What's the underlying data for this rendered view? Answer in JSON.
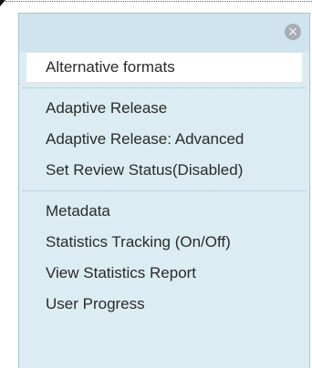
{
  "menu": {
    "close_icon": "×",
    "groups": [
      {
        "items": [
          {
            "label": "Alternative formats",
            "highlighted": true
          }
        ]
      },
      {
        "items": [
          {
            "label": "Adaptive Release"
          },
          {
            "label": "Adaptive Release: Advanced"
          },
          {
            "label": "Set Review Status(Disabled)"
          }
        ]
      },
      {
        "items": [
          {
            "label": "Metadata"
          },
          {
            "label": "Statistics Tracking (On/Off)"
          },
          {
            "label": "View Statistics Report"
          },
          {
            "label": "User Progress"
          }
        ]
      }
    ]
  },
  "icons": {
    "close": "close-icon"
  },
  "colors": {
    "menu_header_bg": "#cfe4ee",
    "menu_body_bg": "#dcecf3",
    "highlight_bg": "#ffffff",
    "text": "#2a2a2a"
  }
}
